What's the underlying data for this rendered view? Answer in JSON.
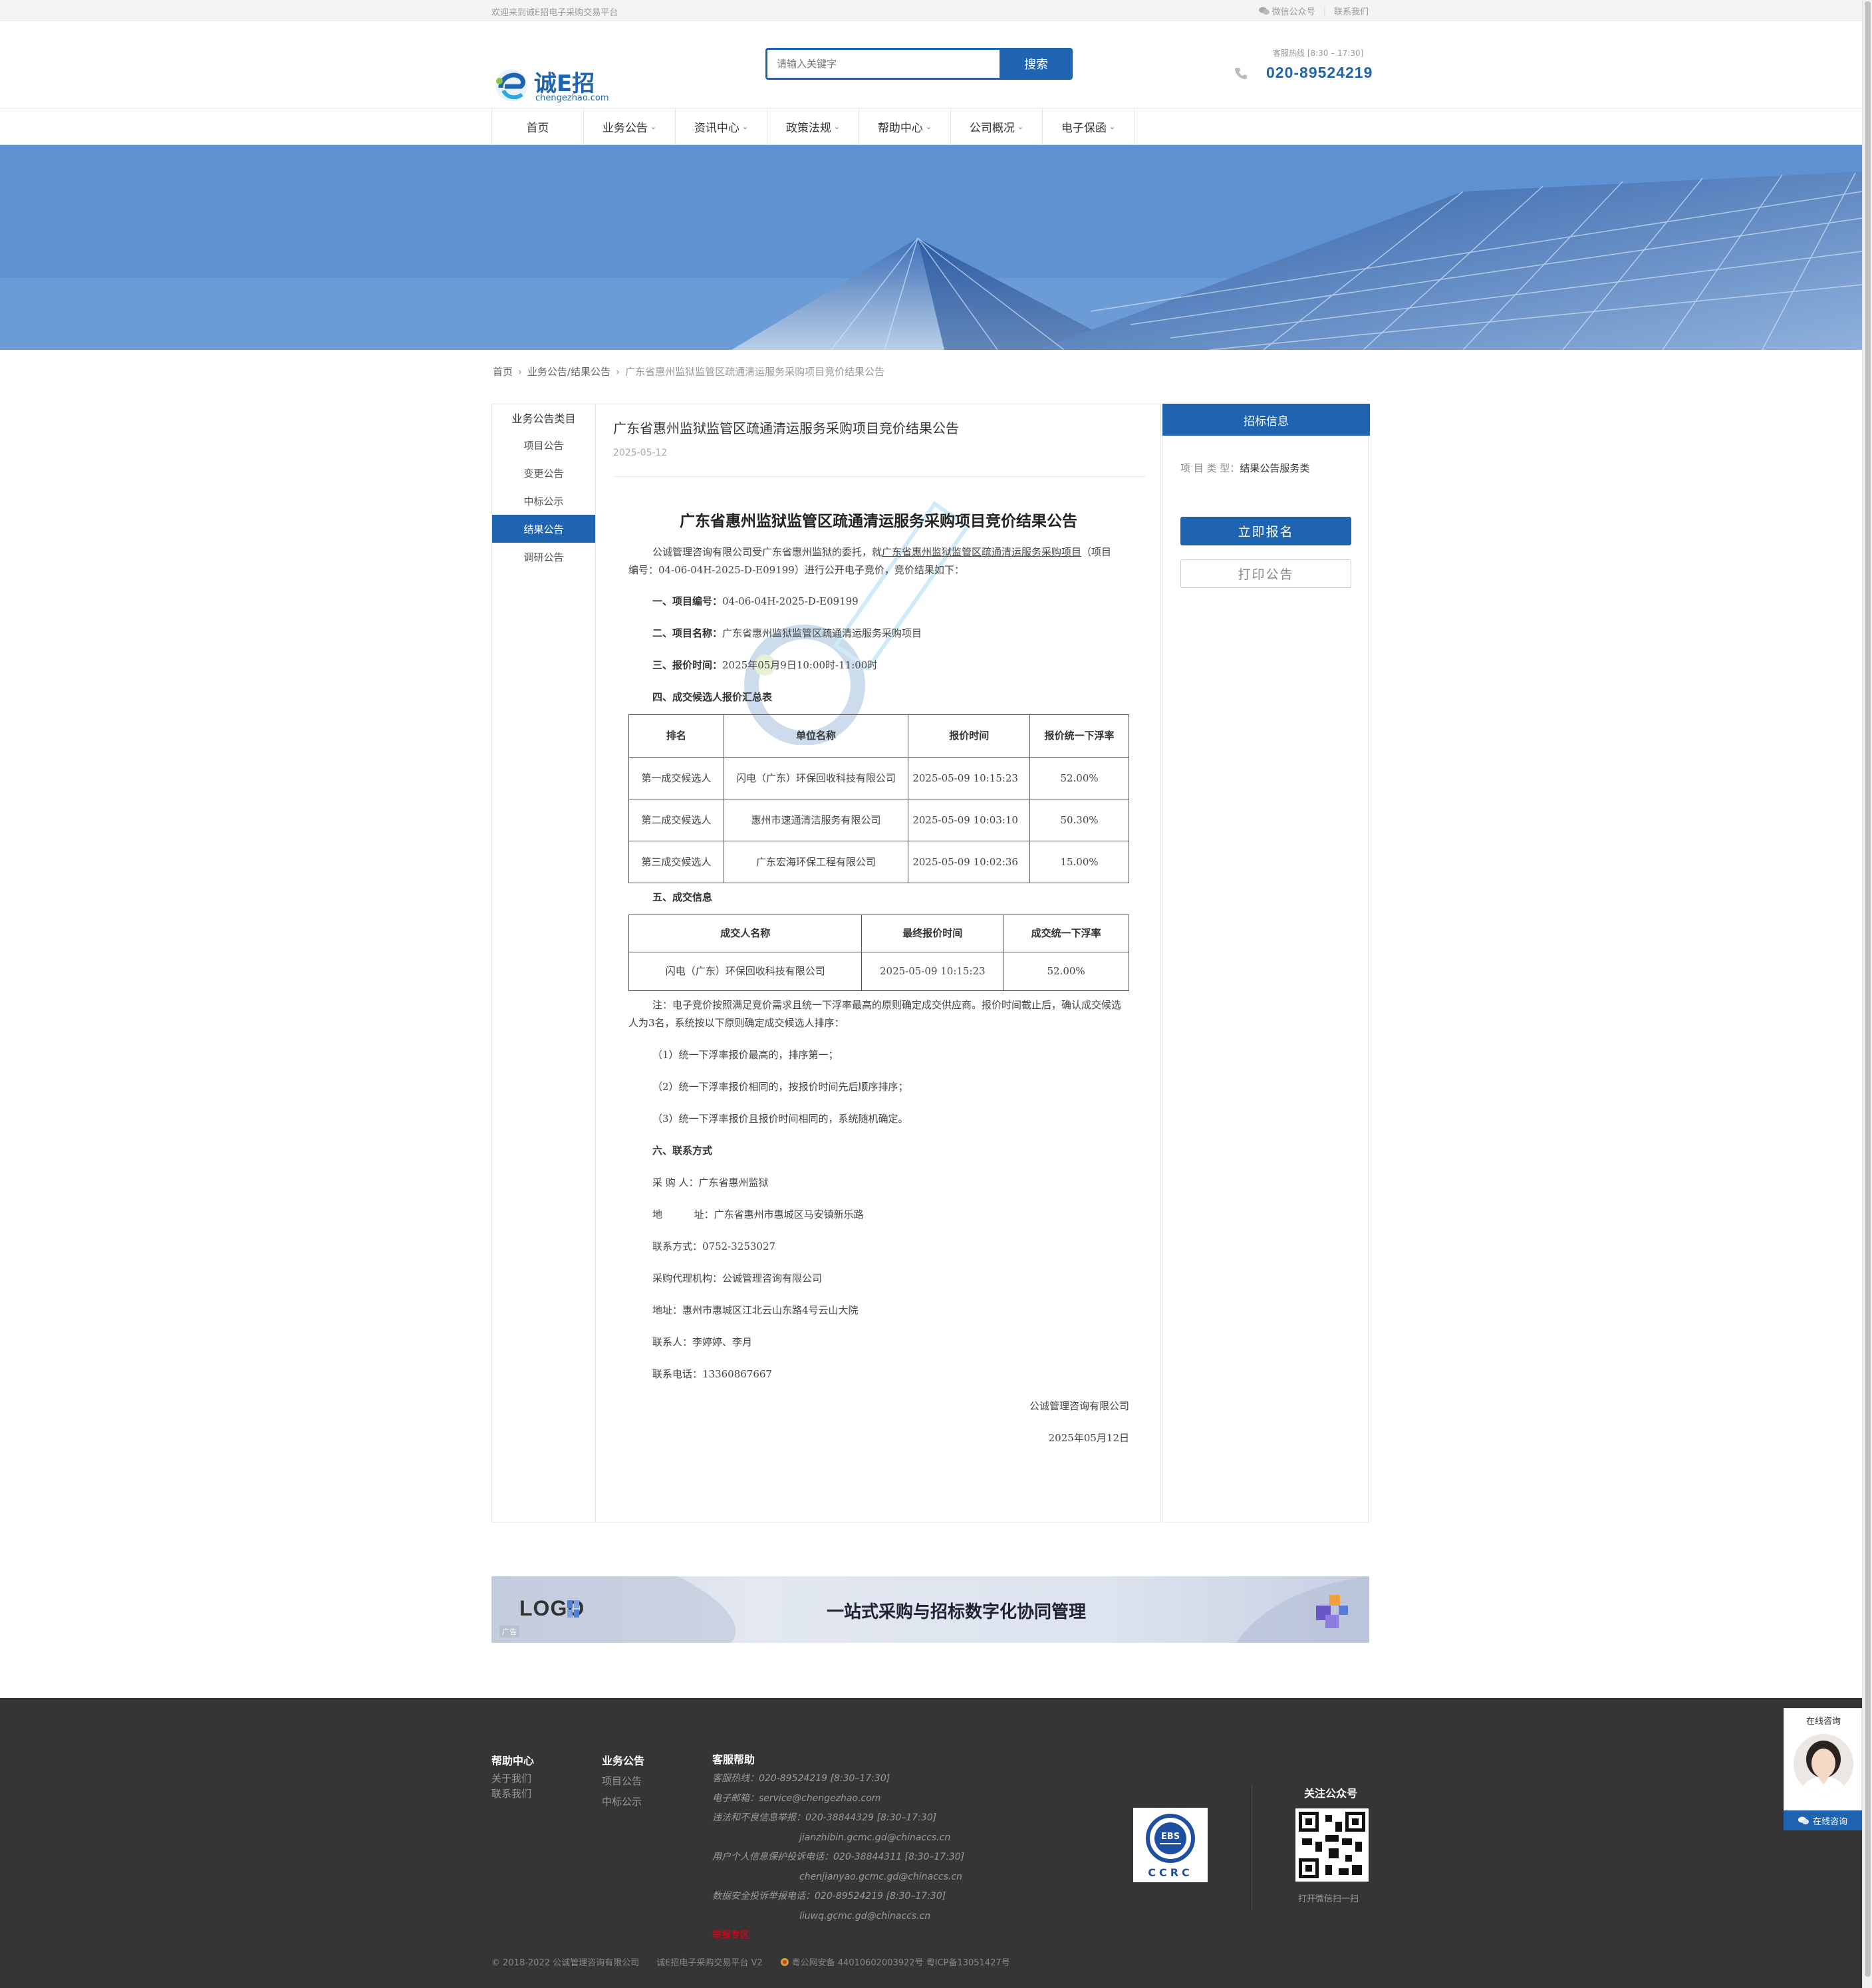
{
  "topbar": {
    "welcome": "欢迎来到诚E招电子采购交易平台",
    "wechat": "微信公众号",
    "contact": "联系我们"
  },
  "header": {
    "logo_text": "诚E招",
    "logo_domain": "chengezhao.com",
    "search_placeholder": "请输入关键字",
    "search_button": "搜索",
    "hotline_label": "客服热线 [8:30 – 17:30]",
    "hotline": "020-89524219"
  },
  "nav": {
    "items": [
      "首页",
      "业务公告",
      "资讯中心",
      "政策法规",
      "帮助中心",
      "公司概况",
      "电子保函"
    ]
  },
  "breadcrumb": {
    "home": "首页",
    "category": "业务公告/结果公告",
    "current": "广东省惠州监狱监管区疏通清运服务采购项目竞价结果公告"
  },
  "sidebar": {
    "title": "业务公告类目",
    "items": [
      "项目公告",
      "变更公告",
      "中标公示",
      "结果公告",
      "调研公告"
    ]
  },
  "article": {
    "title": "广东省惠州监狱监管区疏通清运服务采购项目竞价结果公告",
    "date": "2025-05-12",
    "doc_title": "广东省惠州监狱监管区疏通清运服务采购项目竞价结果公告",
    "intro_a": "公诚管理咨询有限公司受广东省惠州监狱的委托，就",
    "intro_link1": "广东省惠州监狱监管区疏通清运服务",
    "intro_link2": "采购项目",
    "intro_b": "（项目编号：04-06-04H-2025-D-E09199）进行公开电子竞价，竞价结果如下：",
    "s1_label": "一、项目编号：",
    "s1_value": "04-06-04H-2025-D-E09199",
    "s2_label": "二、项目名称：",
    "s2_value": "广东省惠州监狱监管区疏通清运服务采购项目",
    "s3_label": "三、报价时间：",
    "s3_value": "2025年05月9日10:00时-11:00时",
    "s4_label": "四、成交候选人报价汇总表",
    "table1": {
      "headers": [
        "排名",
        "单位名称",
        "报价时间",
        "报价统一下浮率"
      ],
      "rows": [
        [
          "第一成交候选人",
          "闪电（广东）环保回收科技有限公司",
          "2025-05-09 10:15:23",
          "52.00%"
        ],
        [
          "第二成交候选人",
          "惠州市速通清洁服务有限公司",
          "2025-05-09 10:03:10",
          "50.30%"
        ],
        [
          "第三成交候选人",
          "广东宏海环保工程有限公司",
          "2025-05-09 10:02:36",
          "15.00%"
        ]
      ]
    },
    "s5_label": "五、成交信息",
    "table2": {
      "headers": [
        "成交人名称",
        "最终报价时间",
        "成交统一下浮率"
      ],
      "rows": [
        [
          "闪电（广东）环保回收科技有限公司",
          "2025-05-09 10:15:23",
          "52.00%"
        ]
      ]
    },
    "note": "注：电子竞价按照满足竞价需求且统一下浮率最高的原则确定成交供应商。报价时间截止后，确认成交候选人为3名，系统按以下原则确定成交候选人排序：",
    "rule1": "（1）统一下浮率报价最高的，排序第一；",
    "rule2": "（2）统一下浮率报价相同的，按报价时间先后顺序排序；",
    "rule3": "（3）统一下浮率报价且报价时间相同的，系统随机确定。",
    "s6_label": "六、联系方式",
    "buyer": "采 购 人：广东省惠州监狱",
    "buyer_addr": "地          址：广东省惠州市惠城区马安镇新乐路",
    "buyer_tel": "联系方式：0752-3253027",
    "agent": "采购代理机构：公诚管理咨询有限公司",
    "agent_addr": "地址：惠州市惠城区江北云山东路4号云山大院",
    "agent_contact": "联系人：李婷婷、李月",
    "agent_tel": "联系电话：13360867667",
    "signer": "公诚管理咨询有限公司",
    "sign_date": "2025年05月12日"
  },
  "right": {
    "title": "招标信息",
    "type_label": "项 目 类 型：",
    "type_value": "结果公告服务类",
    "signup": "立即报名",
    "print": "打印公告"
  },
  "ad": {
    "logo": "LOGO",
    "slogan": "一站式采购与招标数字化协同管理",
    "tag": "广告"
  },
  "footer": {
    "help_title": "帮助中心",
    "help_items": [
      "关于我们",
      "联系我们"
    ],
    "biz_title": "业务公告",
    "biz_items": [
      "项目公告",
      "中标公示"
    ],
    "service_title": "客服帮助",
    "service_lines": [
      "客服热线：020-89524219 [8:30–17:30]",
      "电子邮箱：service@chengezhao.com",
      "违法和不良信息举报：020-38844329 [8:30–17:30]",
      "jianzhibin.gcmc.gd@chinaccs.cn",
      "用户个人信息保护投诉电话：020-38844311 [8:30–17:30]",
      "chenjianyao.gcmc.gd@chinaccs.cn",
      "数据安全投诉举报电话：020-89524219 [8:30–17:30]",
      "liuwq.gcmc.gd@chinaccs.cn"
    ],
    "report_zone": "举报专区",
    "follow": "关注公众号",
    "scan": "打开微信扫一扫",
    "ccrc_text": "CCRC",
    "ebs_text": "EBS",
    "copyright": "© 2018-2022 公诚管理咨询有限公司",
    "platform": "诚E招电子采购交易平台 V2",
    "icp": "粤公网安备 44010602003922号  粤ICP备13051427号"
  },
  "float": {
    "title": "在线咨询",
    "button": "在线咨询"
  },
  "colors": {
    "brand": "#1f64b0",
    "footer_bg": "#353535"
  }
}
